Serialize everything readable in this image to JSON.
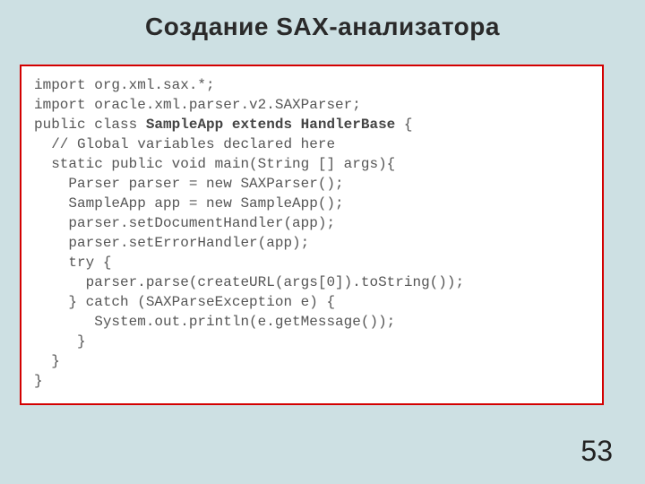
{
  "title": "Создание SAX-анализатора",
  "code": {
    "l1": "import org.xml.sax.*;",
    "l2": "import oracle.xml.parser.v2.SAXParser;",
    "l3a": "public class ",
    "l3b": "SampleApp extends HandlerBase",
    "l3c": " {",
    "l4": "  // Global variables declared here",
    "l5": "  static public void main(String [] args){",
    "l6": "    Parser parser = new SAXParser();",
    "l7": "    SampleApp app = new SampleApp();",
    "l8": "    parser.setDocumentHandler(app);",
    "l9": "    parser.setErrorHandler(app);",
    "l10": "    try {",
    "l11": "      parser.parse(createURL(args[0]).toString());",
    "l12": "    } catch (SAXParseException e) {",
    "l13": "       System.out.println(e.getMessage());",
    "l14": "     }",
    "l15": "  }",
    "l16": "}"
  },
  "page_number": "53"
}
